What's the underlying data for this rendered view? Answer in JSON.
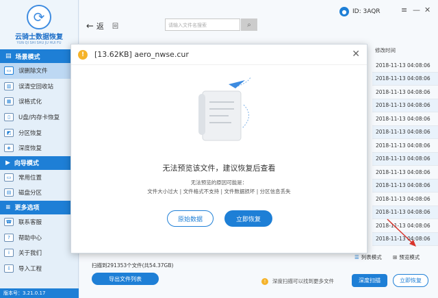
{
  "sidebar": {
    "logo": {
      "title": "云骑士数据恢复",
      "subtitle": "YUN QI SHI SHU JU HUI FU"
    },
    "sections": [
      {
        "label": "场景模式",
        "items": [
          "误删除文件",
          "误清空回收站",
          "误格式化",
          "U盘/内存卡恢复",
          "分区恢复",
          "深度恢复"
        ]
      },
      {
        "label": "向导模式",
        "items": [
          "常用位置",
          "磁盘分区"
        ]
      },
      {
        "label": "更多选项",
        "items": [
          "联系客服",
          "帮助中心",
          "关于我们",
          "导入工程"
        ]
      }
    ],
    "version": "版本号：3.21.0.17"
  },
  "header": {
    "back_label": "返",
    "home_label": "回",
    "search_placeholder": "请输入文件名搜索",
    "user_id": "ID: 3AQR"
  },
  "file_list": {
    "column_header": "修改时间",
    "times": [
      "2018-11-13 04:08:06",
      "2018-11-13 04:08:06",
      "2018-11-13 04:08:06",
      "2018-11-13 04:08:06",
      "2018-11-13 04:08:06",
      "2018-11-13 04:08:06",
      "2018-11-13 04:08:06",
      "2018-11-13 04:08:06",
      "2018-11-13 04:08:06",
      "2018-11-13 04:08:06",
      "2018-11-13 04:08:06",
      "2018-11-13 04:08:06",
      "2018-11-13 04:08:06",
      "2018-11-13 04:08:06"
    ]
  },
  "view": {
    "list_label": "列表模式",
    "preview_label": "预览模式"
  },
  "footer": {
    "scan_info": "扫描到291353个文件(共54.37GB)",
    "export_label": "导出文件列表",
    "tip": "深度扫描可以找到更多文件",
    "deep_scan_label": "深度扫描",
    "recover_label": "立即恢复"
  },
  "modal": {
    "title": "[13.62KB] aero_nwse.cur",
    "message": "无法预览该文件，建议恢复后查看",
    "reason_title": "无法预览的原因可能是：",
    "reasons": "文件大小过大 | 文件格式不支持 | 文件数据损坏 | 分区信息丢失",
    "raw_label": "原始数据",
    "recover_now_label": "立即恢复"
  },
  "colors": {
    "accent": "#1e7fd6",
    "warning": "#f5b32a",
    "arrow": "#d9342b"
  }
}
